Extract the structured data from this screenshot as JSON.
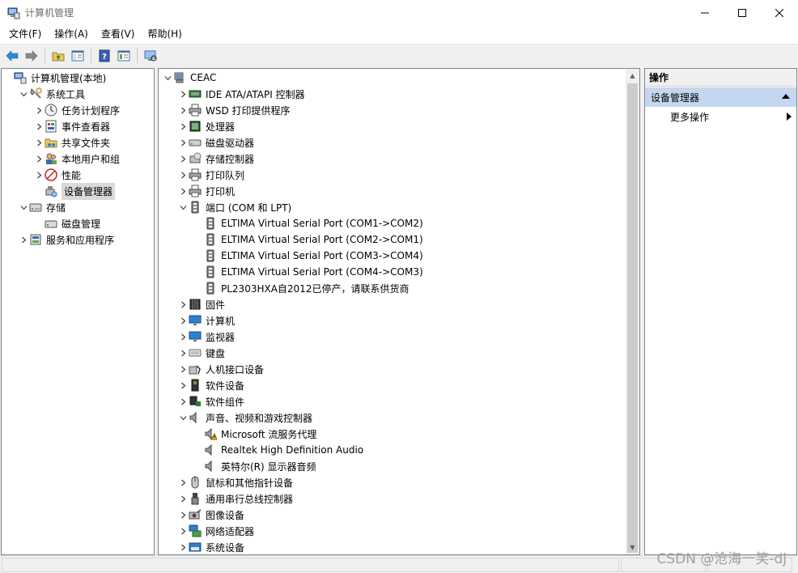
{
  "window": {
    "title": "计算机管理"
  },
  "menu": [
    "文件(F)",
    "操作(A)",
    "查看(V)",
    "帮助(H)"
  ],
  "left_tree": [
    {
      "label": "计算机管理(本地)",
      "level": 0,
      "expand": "",
      "icon": "computer-mgmt-icon",
      "selected": false
    },
    {
      "label": "系统工具",
      "level": 1,
      "expand": "open",
      "icon": "tools-icon",
      "selected": false
    },
    {
      "label": "任务计划程序",
      "level": 2,
      "expand": "closed",
      "icon": "clock-icon",
      "selected": false
    },
    {
      "label": "事件查看器",
      "level": 2,
      "expand": "closed",
      "icon": "event-viewer-icon",
      "selected": false
    },
    {
      "label": "共享文件夹",
      "level": 2,
      "expand": "closed",
      "icon": "shared-folder-icon",
      "selected": false
    },
    {
      "label": "本地用户和组",
      "level": 2,
      "expand": "closed",
      "icon": "users-icon",
      "selected": false
    },
    {
      "label": "性能",
      "level": 2,
      "expand": "closed",
      "icon": "performance-icon",
      "selected": false
    },
    {
      "label": "设备管理器",
      "level": 2,
      "expand": "",
      "icon": "device-manager-icon",
      "selected": true
    },
    {
      "label": "存储",
      "level": 1,
      "expand": "open",
      "icon": "storage-icon",
      "selected": false
    },
    {
      "label": "磁盘管理",
      "level": 2,
      "expand": "",
      "icon": "disk-mgmt-icon",
      "selected": false
    },
    {
      "label": "服务和应用程序",
      "level": 1,
      "expand": "closed",
      "icon": "services-icon",
      "selected": false
    }
  ],
  "device_tree": [
    {
      "label": "CEAC",
      "level": 0,
      "expand": "open",
      "icon": "computer-root-icon"
    },
    {
      "label": "IDE ATA/ATAPI 控制器",
      "level": 1,
      "expand": "closed",
      "icon": "ide-controller-icon"
    },
    {
      "label": "WSD 打印提供程序",
      "level": 1,
      "expand": "closed",
      "icon": "printer-icon"
    },
    {
      "label": "处理器",
      "level": 1,
      "expand": "closed",
      "icon": "processor-icon"
    },
    {
      "label": "磁盘驱动器",
      "level": 1,
      "expand": "closed",
      "icon": "disk-drive-icon"
    },
    {
      "label": "存储控制器",
      "level": 1,
      "expand": "closed",
      "icon": "storage-controller-icon"
    },
    {
      "label": "打印队列",
      "level": 1,
      "expand": "closed",
      "icon": "printer-icon"
    },
    {
      "label": "打印机",
      "level": 1,
      "expand": "closed",
      "icon": "printer-icon"
    },
    {
      "label": "端口 (COM 和 LPT)",
      "level": 1,
      "expand": "open",
      "icon": "port-icon"
    },
    {
      "label": "ELTIMA Virtual Serial Port (COM1->COM2)",
      "level": 2,
      "expand": "",
      "icon": "port-icon"
    },
    {
      "label": "ELTIMA Virtual Serial Port (COM2->COM1)",
      "level": 2,
      "expand": "",
      "icon": "port-icon"
    },
    {
      "label": "ELTIMA Virtual Serial Port (COM3->COM4)",
      "level": 2,
      "expand": "",
      "icon": "port-icon"
    },
    {
      "label": "ELTIMA Virtual Serial Port (COM4->COM3)",
      "level": 2,
      "expand": "",
      "icon": "port-icon"
    },
    {
      "label": "PL2303HXA自2012已停产，请联系供货商",
      "level": 2,
      "expand": "",
      "icon": "port-icon"
    },
    {
      "label": "固件",
      "level": 1,
      "expand": "closed",
      "icon": "firmware-icon"
    },
    {
      "label": "计算机",
      "level": 1,
      "expand": "closed",
      "icon": "monitor-icon"
    },
    {
      "label": "监视器",
      "level": 1,
      "expand": "closed",
      "icon": "monitor-icon"
    },
    {
      "label": "键盘",
      "level": 1,
      "expand": "closed",
      "icon": "keyboard-icon"
    },
    {
      "label": "人机接口设备",
      "level": 1,
      "expand": "closed",
      "icon": "hid-icon"
    },
    {
      "label": "软件设备",
      "level": 1,
      "expand": "closed",
      "icon": "software-device-icon"
    },
    {
      "label": "软件组件",
      "level": 1,
      "expand": "closed",
      "icon": "software-component-icon"
    },
    {
      "label": "声音、视频和游戏控制器",
      "level": 1,
      "expand": "open",
      "icon": "speaker-icon"
    },
    {
      "label": "Microsoft 流服务代理",
      "level": 2,
      "expand": "",
      "icon": "warning-speaker-icon"
    },
    {
      "label": "Realtek High Definition Audio",
      "level": 2,
      "expand": "",
      "icon": "speaker-icon"
    },
    {
      "label": "英特尔(R) 显示器音频",
      "level": 2,
      "expand": "",
      "icon": "speaker-icon"
    },
    {
      "label": "鼠标和其他指针设备",
      "level": 1,
      "expand": "closed",
      "icon": "mouse-icon"
    },
    {
      "label": "通用串行总线控制器",
      "level": 1,
      "expand": "closed",
      "icon": "usb-icon"
    },
    {
      "label": "图像设备",
      "level": 1,
      "expand": "closed",
      "icon": "camera-icon"
    },
    {
      "label": "网络适配器",
      "level": 1,
      "expand": "closed",
      "icon": "network-icon"
    },
    {
      "label": "系统设备",
      "level": 1,
      "expand": "closed",
      "icon": "system-device-icon"
    }
  ],
  "actions": {
    "header": "操作",
    "section": "设备管理器",
    "more": "更多操作"
  },
  "watermark": "CSDN @沧海一笑-dj",
  "colors": {
    "accent": "#c5d7ee",
    "selection": "#d9d9d9",
    "border": "#828790"
  }
}
